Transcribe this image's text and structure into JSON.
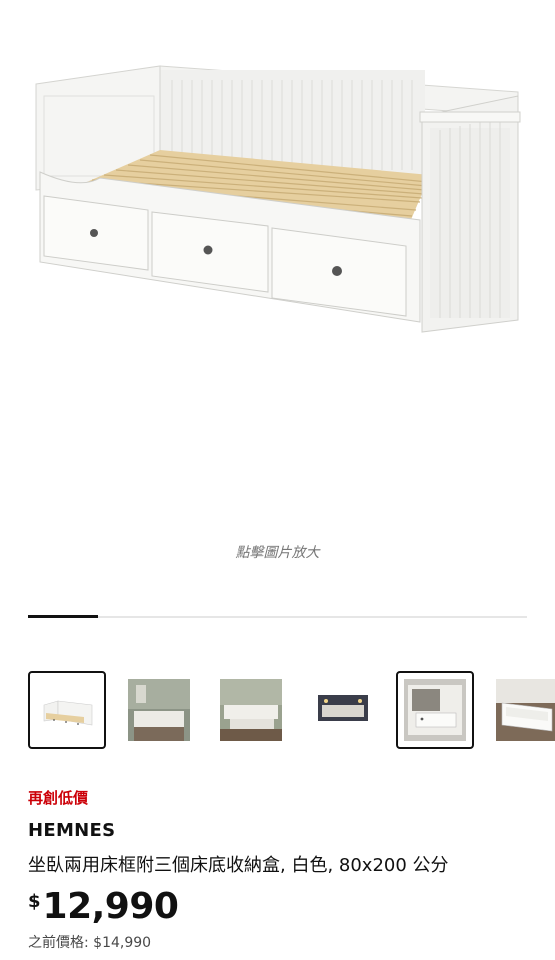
{
  "gallery": {
    "zoom_hint": "點擊圖片放大",
    "progress_fraction": 0.14,
    "selected_index": 0,
    "thumbnails": [
      {
        "label": "white daybed with three drawers",
        "selected": true
      },
      {
        "label": "daybed in green room scene",
        "selected": false
      },
      {
        "label": "daybed room scene with pull-out bed",
        "selected": false
      },
      {
        "label": "daybed dark room scene",
        "selected": false
      },
      {
        "label": "drawer detail close-up",
        "selected": true
      },
      {
        "label": "open drawer detail",
        "selected": false
      }
    ]
  },
  "product": {
    "badge": "再創低價",
    "name": "HEMNES",
    "description": "坐臥兩用床框附三個床底收納盒, 白色, 80x200 公分",
    "currency": "$",
    "price": "12,990",
    "previous_price": "之前價格: $14,990"
  },
  "colors": {
    "accent_red": "#cc0008",
    "text": "#111111",
    "muted": "#767676"
  }
}
